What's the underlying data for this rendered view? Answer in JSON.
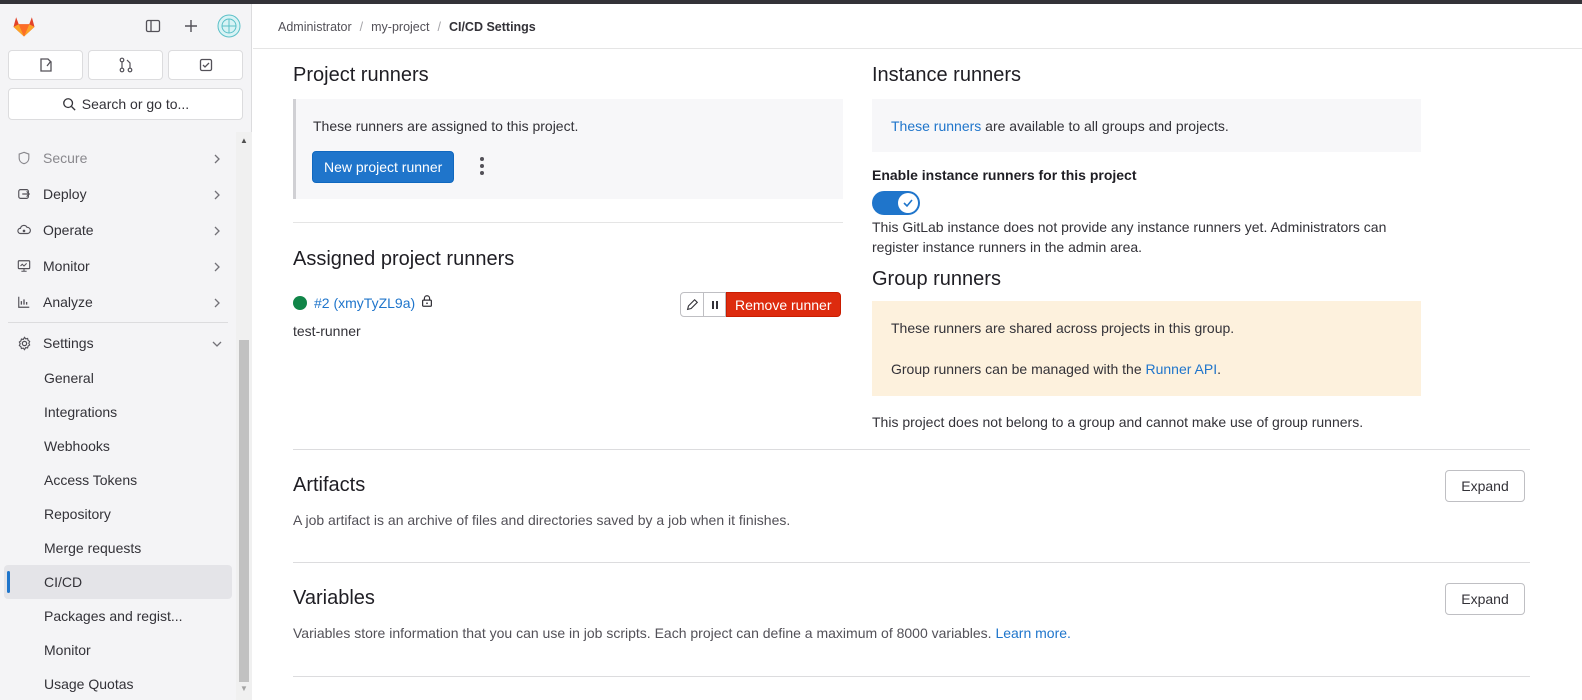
{
  "breadcrumb": {
    "items": [
      "Administrator",
      "my-project"
    ],
    "current": "CI/CD Settings",
    "separator": "/"
  },
  "sidebar": {
    "search_label": "Search or go to...",
    "nav": [
      {
        "label": "Secure",
        "icon": "shield-icon"
      },
      {
        "label": "Deploy",
        "icon": "rocket-icon"
      },
      {
        "label": "Operate",
        "icon": "cloud-gear-icon"
      },
      {
        "label": "Monitor",
        "icon": "monitor-icon"
      },
      {
        "label": "Analyze",
        "icon": "chart-icon"
      },
      {
        "label": "Settings",
        "icon": "gear-icon"
      }
    ],
    "settings_sub": [
      "General",
      "Integrations",
      "Webhooks",
      "Access Tokens",
      "Repository",
      "Merge requests",
      "CI/CD",
      "Packages and regist...",
      "Monitor",
      "Usage Quotas"
    ]
  },
  "project_runners": {
    "title": "Project runners",
    "description": "These runners are assigned to this project.",
    "new_button": "New project runner"
  },
  "assigned": {
    "title": "Assigned project runners",
    "runner_id": "#2 (xmyTyZL9a)",
    "runner_name": "test-runner",
    "remove_button": "Remove runner"
  },
  "instance_runners": {
    "title": "Instance runners",
    "link": "These runners",
    "desc_rest": " are available to all groups and projects.",
    "enable_label": "Enable instance runners for this project",
    "toggle_on": true,
    "help": "This GitLab instance does not provide any instance runners yet. Administrators can register instance runners in the admin area."
  },
  "group_runners": {
    "title": "Group runners",
    "line1": "These runners are shared across projects in this group.",
    "line2_pre": "Group runners can be managed with the ",
    "line2_link": "Runner API",
    "line2_post": ".",
    "note": "This project does not belong to a group and cannot make use of group runners."
  },
  "artifacts": {
    "title": "Artifacts",
    "description": "A job artifact is an archive of files and directories saved by a job when it finishes.",
    "expand": "Expand"
  },
  "variables": {
    "title": "Variables",
    "description": "Variables store information that you can use in job scripts. Each project can define a maximum of 8000 variables. ",
    "learn_more": "Learn more.",
    "expand": "Expand"
  },
  "colors": {
    "primary": "#1f75cb",
    "danger": "#dd2b0e",
    "success": "#108548",
    "warning_bg": "#fdf1dd"
  }
}
